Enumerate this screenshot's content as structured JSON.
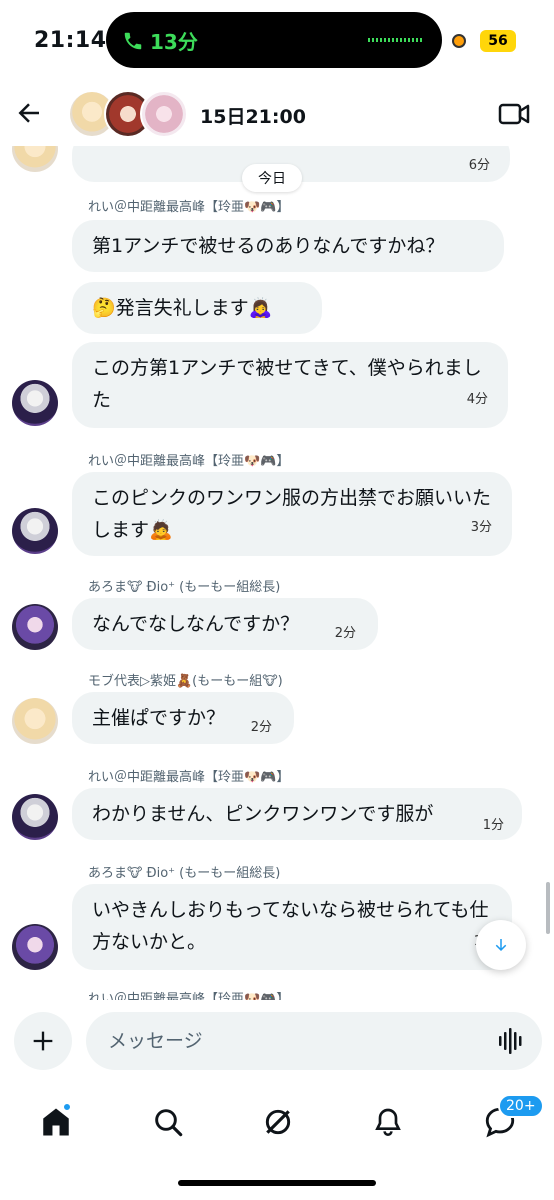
{
  "status_bar": {
    "time": "21:14",
    "call_duration": "13分",
    "battery": "56",
    "colors": {
      "call_green": "#3ddc5a",
      "battery_yellow": "#ffd60a",
      "recording_orange": "#ff9f0a"
    }
  },
  "header": {
    "title": "15日21:00",
    "back_icon": "arrow-left-icon",
    "video_icon": "video-camera-icon"
  },
  "chat": {
    "today_label": "今日",
    "top_partial_time": "6分",
    "messages": [
      {
        "sender": "れい＠中距離最高峰【玲亜🐶🎮】",
        "text": "第1アンチで被せるのありなんですかね？",
        "time": ""
      },
      {
        "sender": "",
        "text": "🤔発言失礼します🙇‍♀️",
        "time": ""
      },
      {
        "sender": "",
        "text": "この方第1アンチで被せてきて、僕やられました",
        "time": "4分"
      },
      {
        "sender": "れい＠中距離最高峰【玲亜🐶🎮】",
        "text": "このピンクのワンワン服の方出禁でお願いいたします🙇",
        "time": "3分"
      },
      {
        "sender": "あろま🐮 Ðio⁺ (もーもー組総長)",
        "text": "なんでなしなんですか？",
        "time": "2分"
      },
      {
        "sender": "モブ代表▷紫姫🧸(もーもー組🐮)",
        "text": "主催ぱですか？",
        "time": "2分"
      },
      {
        "sender": "れい＠中距離最高峰【玲亜🐶🎮】",
        "text": "わかりません、ピンクワンワンです服が",
        "time": "1分"
      },
      {
        "sender": "あろま🐮 Ðio⁺ (もーもー組総長)",
        "text": "いやきんしおりもってないなら被せられても仕方ないかと。",
        "time": "1"
      },
      {
        "sender": "れい＠中距離最高峰【玲亜🐶🎮】",
        "text": "",
        "time": ""
      }
    ]
  },
  "composer": {
    "placeholder": "メッセージ",
    "plus_icon": "plus-icon",
    "voice_icon": "voice-waveform-icon"
  },
  "tabbar": {
    "items": [
      "home-icon",
      "search-icon",
      "grok-icon",
      "bell-icon",
      "messages-icon"
    ],
    "messages_badge": "20+",
    "accent": "#1d9bf0"
  }
}
